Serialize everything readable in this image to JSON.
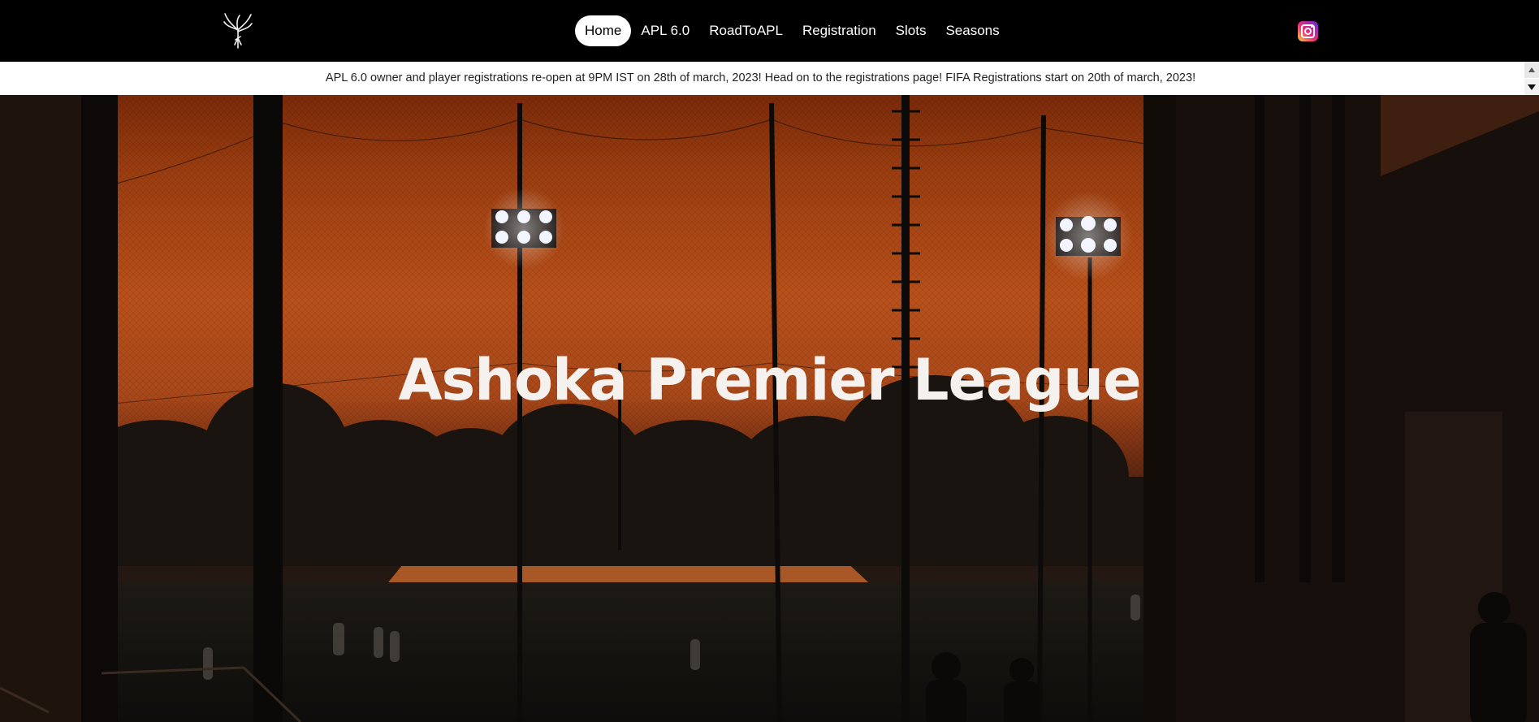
{
  "navbar": {
    "logo_icon": "phoenix-logo-icon",
    "links": [
      {
        "label": "Home",
        "active": true
      },
      {
        "label": "APL 6.0",
        "active": false
      },
      {
        "label": "RoadToAPL",
        "active": false
      },
      {
        "label": "Registration",
        "active": false
      },
      {
        "label": "Slots",
        "active": false
      },
      {
        "label": "Seasons",
        "active": false
      }
    ],
    "social_icon": "instagram-icon"
  },
  "announcement": {
    "text": "APL 6.0 owner and player registrations re-open at 9PM IST on 28th of march, 2023! Head on to the registrations page! FIFA Registrations start on 20th of march, 2023!"
  },
  "hero": {
    "title": "Ashoka Premier League"
  },
  "colors": {
    "nav_bg": "#000000",
    "sky_orange": "#b8501a",
    "title": "#f4f1ee"
  }
}
